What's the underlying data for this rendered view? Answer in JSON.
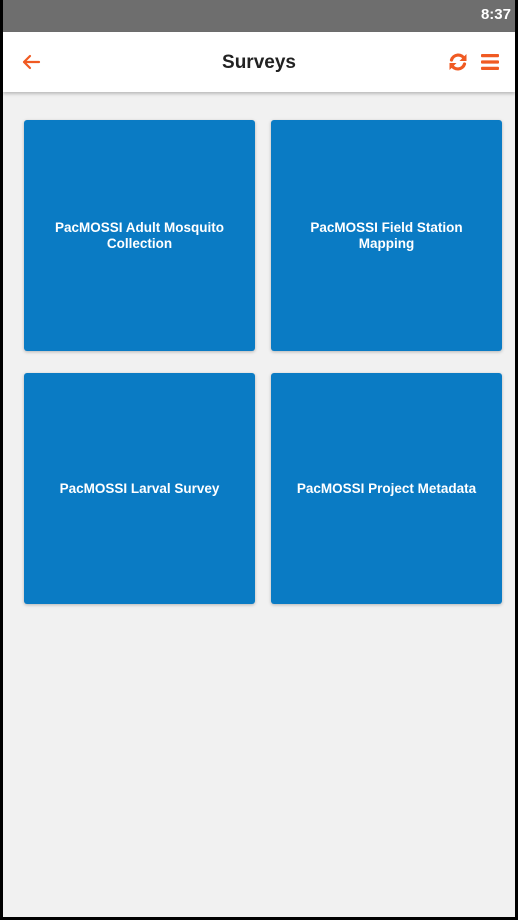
{
  "status_bar": {
    "time": "8:37"
  },
  "header": {
    "title": "Surveys",
    "back_icon": "arrow-left-icon",
    "refresh_icon": "refresh-icon",
    "menu_icon": "hamburger-menu-icon"
  },
  "surveys": [
    {
      "label": "PacMOSSI Adult Mosquito Collection"
    },
    {
      "label": "PacMOSSI Field Station Mapping"
    },
    {
      "label": "PacMOSSI Larval Survey"
    },
    {
      "label": "PacMOSSI Project Metadata"
    }
  ],
  "colors": {
    "accent": "#f05a22",
    "tile": "#0a7bc4",
    "status_bar": "#6e6e6e",
    "background": "#f1f1f1"
  }
}
